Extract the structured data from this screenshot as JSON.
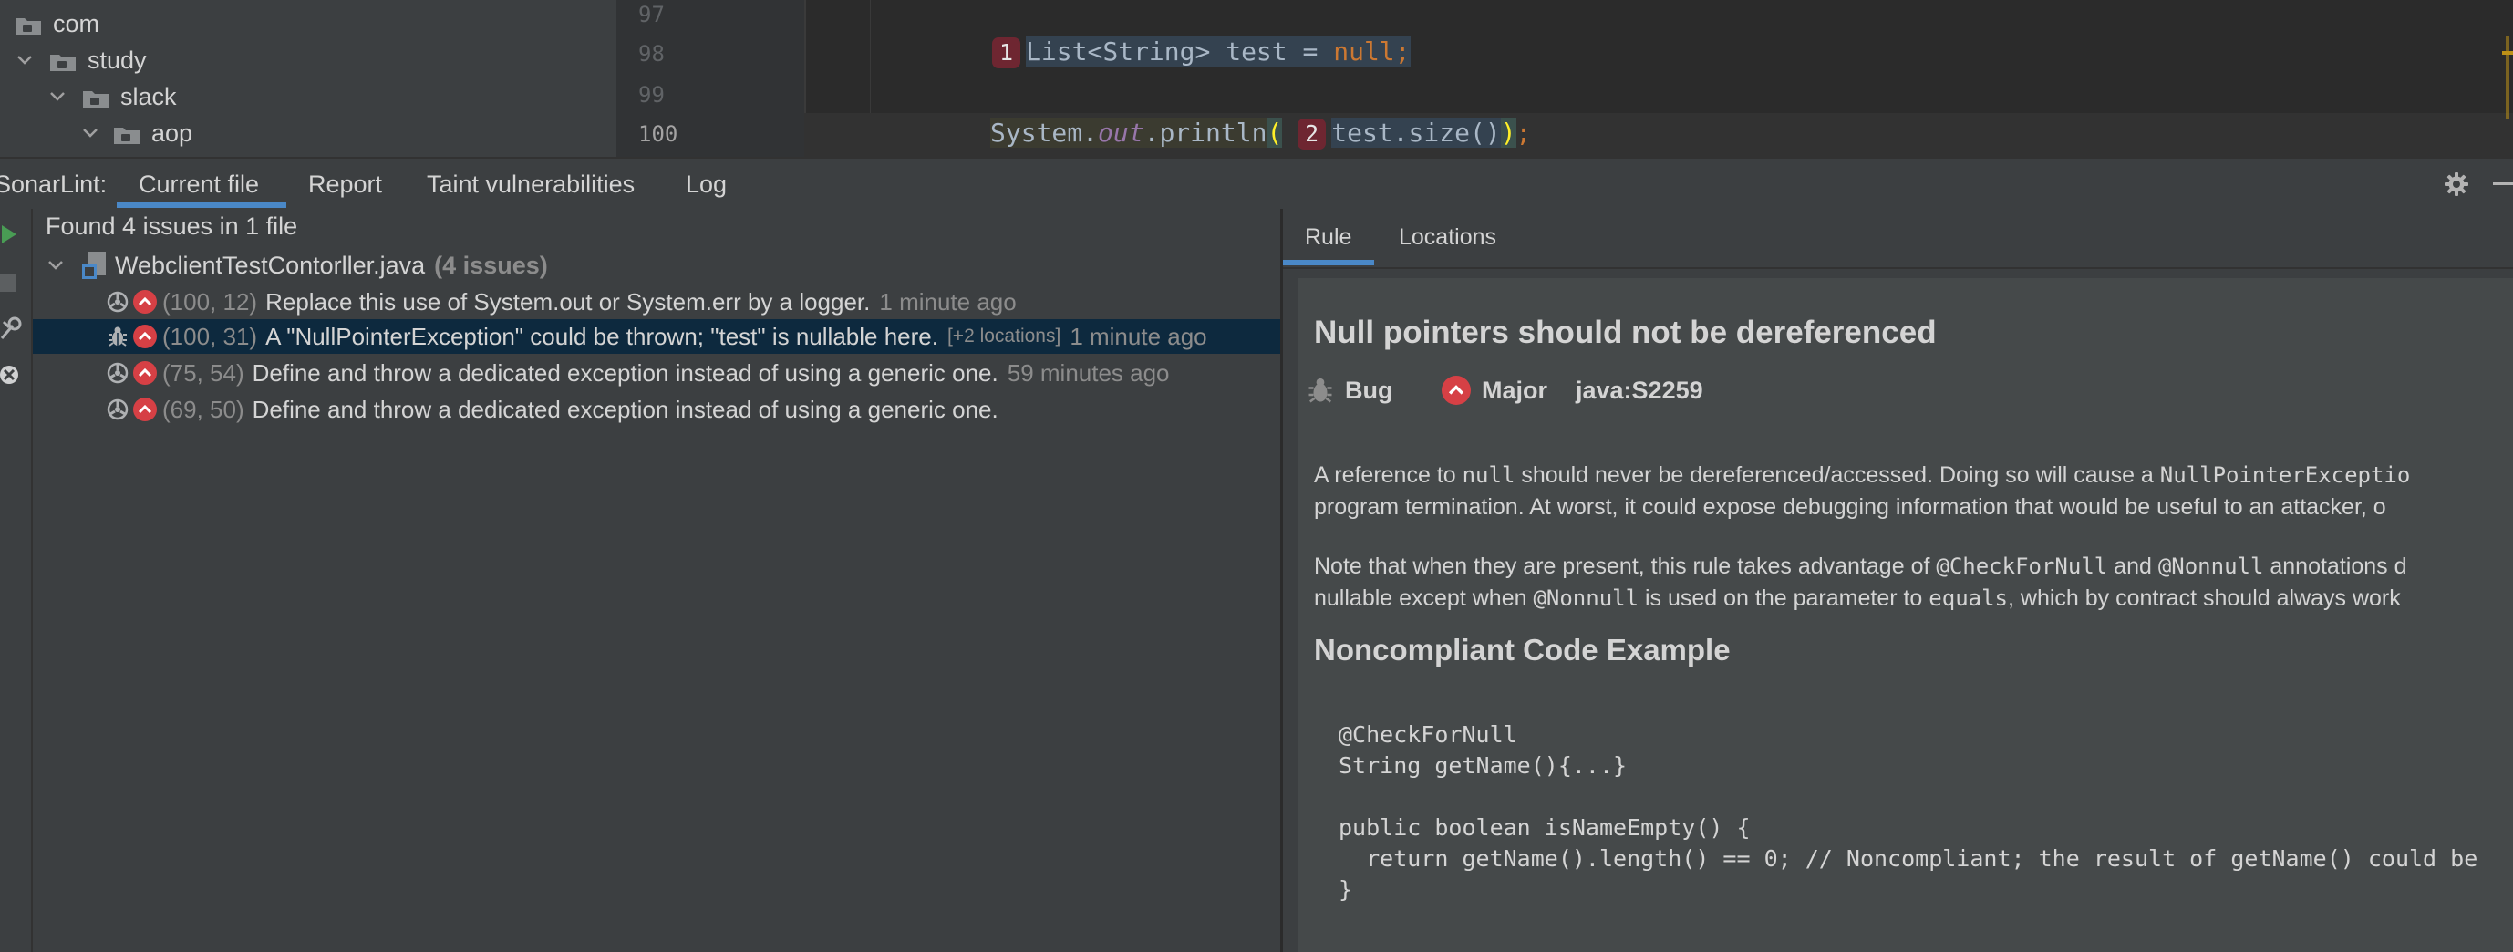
{
  "project_tree": {
    "rows": [
      {
        "label": "com"
      },
      {
        "label": "study"
      },
      {
        "label": "slack"
      },
      {
        "label": "aop"
      }
    ]
  },
  "editor": {
    "line_numbers": [
      "97",
      "98",
      "99",
      "100"
    ],
    "line98": {
      "badge": "1",
      "type": "List<String>",
      "var": "test",
      "assign": " = ",
      "null_kw": "null",
      "semi": ";"
    },
    "line100": {
      "system": "System.",
      "out": "out",
      "println": ".println",
      "open_paren": "(",
      "badge": "2",
      "test": "test",
      "size": ".size()",
      "close_paren": ")",
      "semi": ";"
    }
  },
  "toolbar": {
    "title": "SonarLint:",
    "tabs": [
      "Current file",
      "Report",
      "Taint vulnerabilities",
      "Log"
    ]
  },
  "issues_panel": {
    "summary": "Found 4 issues in 1 file",
    "file_name": "WebclientTestContorller.java",
    "file_count": "(4 issues)",
    "issues": [
      {
        "location": "(100, 12)",
        "message": "Replace this use of System.out or System.err by a logger.",
        "extra": "",
        "age": "1 minute ago",
        "type": "code-smell"
      },
      {
        "location": "(100, 31)",
        "message": "A \"NullPointerException\" could be thrown; \"test\" is nullable here.",
        "extra": "[+2 locations]",
        "age": "1 minute ago",
        "type": "bug"
      },
      {
        "location": "(75, 54)",
        "message": "Define and throw a dedicated exception instead of using a generic one.",
        "extra": "",
        "age": "59 minutes ago",
        "type": "code-smell"
      },
      {
        "location": "(69, 50)",
        "message": "Define and throw a dedicated exception instead of using a generic one.",
        "extra": "",
        "age": "",
        "type": "code-smell"
      }
    ]
  },
  "rule_panel": {
    "tabs": [
      "Rule",
      "Locations"
    ],
    "title": "Null pointers should not be dereferenced",
    "type": "Bug",
    "severity": "Major",
    "key": "java:S2259",
    "para1": {
      "a": "A reference to ",
      "b": "null",
      "c": " should never be dereferenced/accessed. Doing so will cause a ",
      "d": "NullPointerExceptio",
      "line2": "program termination. At worst, it could expose debugging information that would be useful to an attacker, o"
    },
    "para2": {
      "a": "Note that when they are present, this rule takes advantage of ",
      "b": "@CheckForNull",
      "c": " and ",
      "d": "@Nonnull",
      "e": " annotations d",
      "f": "nullable except when ",
      "g": "@Nonnull",
      "h": " is used on the parameter to ",
      "i": "equals",
      "j": ", which by contract should always work"
    },
    "noncompliant_heading": "Noncompliant Code Example",
    "code_lines": [
      "@CheckForNull",
      "String getName(){...}",
      "",
      "public boolean isNameEmpty() {",
      "  return getName().length() == 0; // Noncompliant; the result of getName() could be",
      "}"
    ]
  },
  "colors": {
    "severity": "#d64045",
    "selection": "#0d293e",
    "tab_underline": "#4a88c7"
  }
}
